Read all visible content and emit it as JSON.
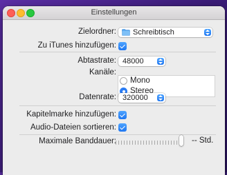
{
  "window": {
    "title": "Einstellungen"
  },
  "labels": {
    "target_folder": "Zielordner:",
    "add_to_itunes": "Zu iTunes hinzufügen:",
    "sample_rate": "Abtastrate:",
    "channels": "Kanäle:",
    "data_rate": "Datenrate:",
    "chapter_marks": "Kapitelmarke hinzufügen:",
    "sort_audio": "Audio-Dateien sortieren:",
    "max_band_duration": "Maximale Banddauer:"
  },
  "values": {
    "target_folder": "Schreibtisch",
    "sample_rate": "48000",
    "data_rate": "320000",
    "channel_options": [
      "Mono",
      "Stereo"
    ],
    "selected_channel": "Stereo",
    "add_to_itunes_checked": true,
    "chapter_marks_checked": true,
    "sort_audio_checked": true,
    "max_band_duration_value": "--",
    "max_band_duration_unit": "Std.",
    "max_band_duration_level": 0.95
  },
  "colors": {
    "accent": "#1e76f1",
    "window_bg": "#ececec",
    "desktop_bg": "#3b1c78"
  },
  "icons": {
    "target_folder": "folder-icon",
    "popup": "chevron-up-down-icon"
  }
}
